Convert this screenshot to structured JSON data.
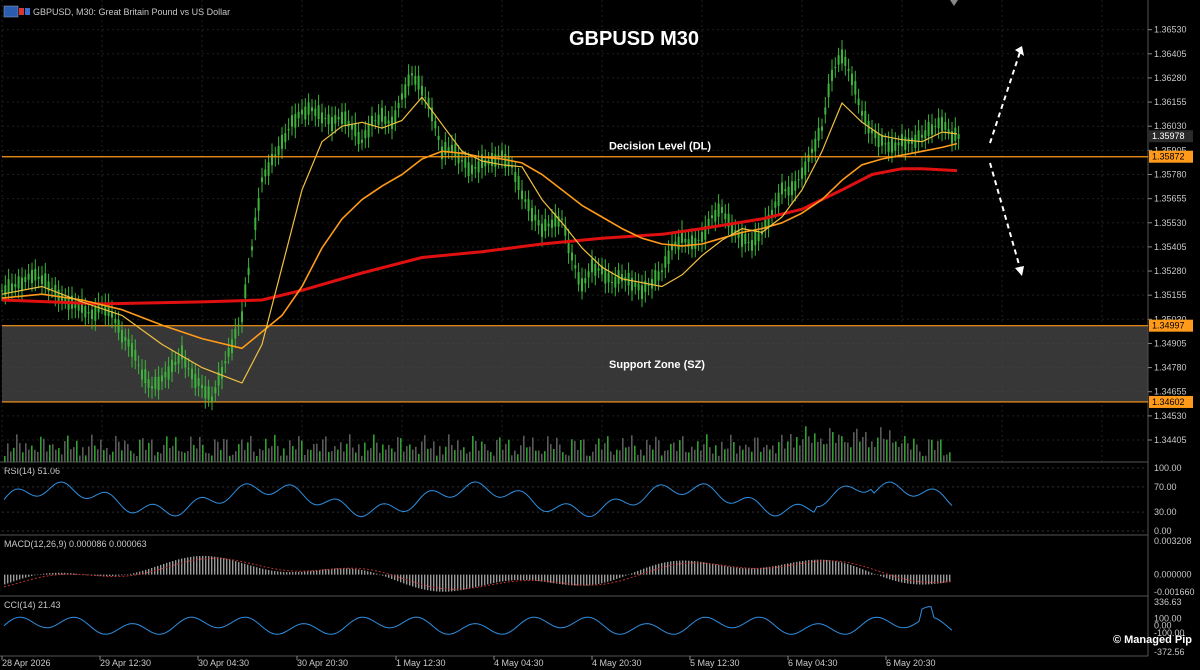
{
  "window": {
    "icon": "mt-chart-icon",
    "symbol_header": "GBPUSD, M30:  Great Britain Pound vs US Dollar"
  },
  "title": "GBPUSD M30",
  "watermark": "© Managed Pip",
  "colors": {
    "background": "#000000",
    "grid": "#1f1f1f",
    "bull_candle": "#3cb43c",
    "ma_fast": "#f0c040",
    "ma_mid": "#ff9a1a",
    "ma_slow": "#e01010",
    "level": "#ff9a1a",
    "zone_fill": "#4a4a4a",
    "indicator_line": "#2f8fe0",
    "macd_signal": "#c03030",
    "volume": "#5a5a5a"
  },
  "chart_data": {
    "type": "line",
    "description_free": true,
    "x_tick_labels": [
      "28 Apr 2026",
      "29 Apr 12:30",
      "30 Apr 04:30",
      "30 Apr 20:30",
      "1 May 12:30",
      "4 May 04:30",
      "4 May 20:30",
      "5 May 12:30",
      "6 May 04:30",
      "6 May 20:30"
    ],
    "y_tick_labels": [
      "1.36530",
      "1.36405",
      "1.36280",
      "1.36155",
      "1.36030",
      "1.35905",
      "1.35780",
      "1.35655",
      "1.35530",
      "1.35405",
      "1.35280",
      "1.35155",
      "1.35030",
      "1.34905",
      "1.34780",
      "1.34655",
      "1.34530",
      "1.34405"
    ],
    "ylim": [
      1.34405,
      1.3658
    ],
    "price_series": {
      "name": "",
      "x": [
        0,
        10,
        20,
        30,
        40,
        50,
        60,
        70,
        80,
        90,
        100,
        110,
        120,
        130,
        140,
        150,
        160,
        170,
        180,
        190,
        200,
        210,
        220,
        230,
        240,
        250,
        260,
        270,
        280,
        290,
        300,
        310,
        320,
        330,
        340,
        350,
        360,
        370,
        380,
        390,
        400,
        410,
        420,
        430,
        440,
        450,
        460,
        470,
        480,
        490,
        500,
        510,
        520,
        530,
        540,
        550,
        560,
        570,
        580,
        590,
        600,
        610,
        620,
        630,
        640,
        650,
        660,
        670,
        680,
        690,
        700,
        710,
        720,
        730,
        740,
        750,
        760,
        770,
        780,
        790,
        800,
        810,
        820,
        830,
        840,
        850,
        860,
        870,
        880,
        890,
        900,
        910,
        920,
        930,
        940,
        950
      ],
      "values": [
        1.3518,
        1.352,
        1.3522,
        1.3526,
        1.3524,
        1.3519,
        1.3514,
        1.3511,
        1.3509,
        1.3505,
        1.351,
        1.3506,
        1.3495,
        1.3488,
        1.3475,
        1.3468,
        1.3472,
        1.3478,
        1.3485,
        1.3474,
        1.3468,
        1.3462,
        1.3476,
        1.349,
        1.3505,
        1.354,
        1.3575,
        1.3585,
        1.3594,
        1.3605,
        1.361,
        1.3612,
        1.3608,
        1.3605,
        1.3608,
        1.3603,
        1.3595,
        1.3605,
        1.3608,
        1.3604,
        1.3618,
        1.363,
        1.3622,
        1.361,
        1.359,
        1.3592,
        1.3585,
        1.358,
        1.3584,
        1.3585,
        1.3588,
        1.3582,
        1.3568,
        1.3558,
        1.355,
        1.3553,
        1.3555,
        1.3535,
        1.352,
        1.353,
        1.3528,
        1.3522,
        1.3525,
        1.3522,
        1.3518,
        1.3522,
        1.3528,
        1.354,
        1.3545,
        1.3542,
        1.3545,
        1.3556,
        1.356,
        1.355,
        1.3545,
        1.3542,
        1.3548,
        1.3558,
        1.357,
        1.357,
        1.3578,
        1.359,
        1.3602,
        1.363,
        1.364,
        1.3628,
        1.361,
        1.36,
        1.3595,
        1.3592,
        1.3595,
        1.3595,
        1.3598,
        1.3602,
        1.3605,
        1.3598
      ]
    },
    "ma_fast": {
      "name": "",
      "x": [
        0,
        40,
        80,
        120,
        160,
        200,
        240,
        260,
        280,
        300,
        320,
        340,
        360,
        380,
        400,
        420,
        440,
        460,
        480,
        500,
        520,
        540,
        560,
        580,
        600,
        620,
        640,
        660,
        680,
        700,
        720,
        740,
        760,
        780,
        800,
        820,
        840,
        860,
        880,
        900,
        920,
        940,
        955
      ],
      "values": [
        1.3516,
        1.352,
        1.3512,
        1.3505,
        1.349,
        1.3478,
        1.347,
        1.349,
        1.353,
        1.357,
        1.3595,
        1.3603,
        1.3605,
        1.3602,
        1.3606,
        1.3618,
        1.3604,
        1.359,
        1.3585,
        1.3583,
        1.3582,
        1.3565,
        1.3553,
        1.354,
        1.353,
        1.3524,
        1.3522,
        1.352,
        1.3526,
        1.3536,
        1.3544,
        1.355,
        1.3548,
        1.3556,
        1.357,
        1.359,
        1.3615,
        1.3605,
        1.3598,
        1.3596,
        1.3595,
        1.36,
        1.3599
      ]
    },
    "ma_mid": {
      "name": "",
      "x": [
        0,
        40,
        80,
        120,
        160,
        200,
        240,
        280,
        300,
        320,
        340,
        360,
        380,
        400,
        420,
        440,
        460,
        480,
        500,
        520,
        540,
        560,
        580,
        600,
        620,
        640,
        660,
        680,
        700,
        720,
        740,
        760,
        780,
        800,
        820,
        840,
        860,
        880,
        900,
        920,
        940,
        955
      ],
      "values": [
        1.3514,
        1.3516,
        1.3513,
        1.3508,
        1.35,
        1.3493,
        1.3488,
        1.3505,
        1.352,
        1.354,
        1.3555,
        1.3565,
        1.3572,
        1.3578,
        1.3586,
        1.359,
        1.3589,
        1.3587,
        1.3586,
        1.3584,
        1.3578,
        1.357,
        1.3562,
        1.3556,
        1.355,
        1.3545,
        1.3542,
        1.3541,
        1.3542,
        1.3545,
        1.3548,
        1.355,
        1.3553,
        1.3558,
        1.3565,
        1.3575,
        1.3583,
        1.3586,
        1.3588,
        1.359,
        1.3592,
        1.3594
      ]
    },
    "ma_slow": {
      "name": "",
      "x": [
        0,
        100,
        200,
        260,
        300,
        360,
        420,
        480,
        540,
        600,
        660,
        700,
        760,
        800,
        840,
        870,
        900,
        920,
        955
      ],
      "values": [
        1.3513,
        1.3511,
        1.3512,
        1.3513,
        1.3518,
        1.3527,
        1.3535,
        1.3538,
        1.3542,
        1.3545,
        1.3547,
        1.355,
        1.3555,
        1.356,
        1.357,
        1.3578,
        1.3581,
        1.3581,
        1.358
      ]
    },
    "levels": [
      {
        "label": "Decision Level (DL)",
        "price": 1.35872,
        "price_label": "1.35872"
      }
    ],
    "current_price_label": "1.35978",
    "current_price": 1.35978,
    "zone": {
      "label": "Support Zone (SZ)",
      "top": 1.34997,
      "bottom": 1.34602,
      "top_label": "1.34997",
      "bottom_label": "1.34602"
    },
    "indicators": {
      "rsi": {
        "header": "RSI(14) 51.06",
        "ticks": [
          "100.00",
          "70.00",
          "30.00",
          "0.00"
        ],
        "ylim": [
          0,
          100
        ],
        "last": 51.06
      },
      "macd": {
        "header": "MACD(12,26,9) 0.000086 0.000063",
        "ticks": [
          "0.003208",
          "0.000000",
          "-0.001660"
        ],
        "ylim": [
          -0.00166,
          0.003208
        ]
      },
      "cci": {
        "header": "CCI(14) 21.43",
        "ticks": [
          "336.63",
          "100.00",
          "0.00",
          "-100.00",
          "-372.56"
        ],
        "ylim": [
          -372.56,
          336.63
        ]
      }
    }
  }
}
